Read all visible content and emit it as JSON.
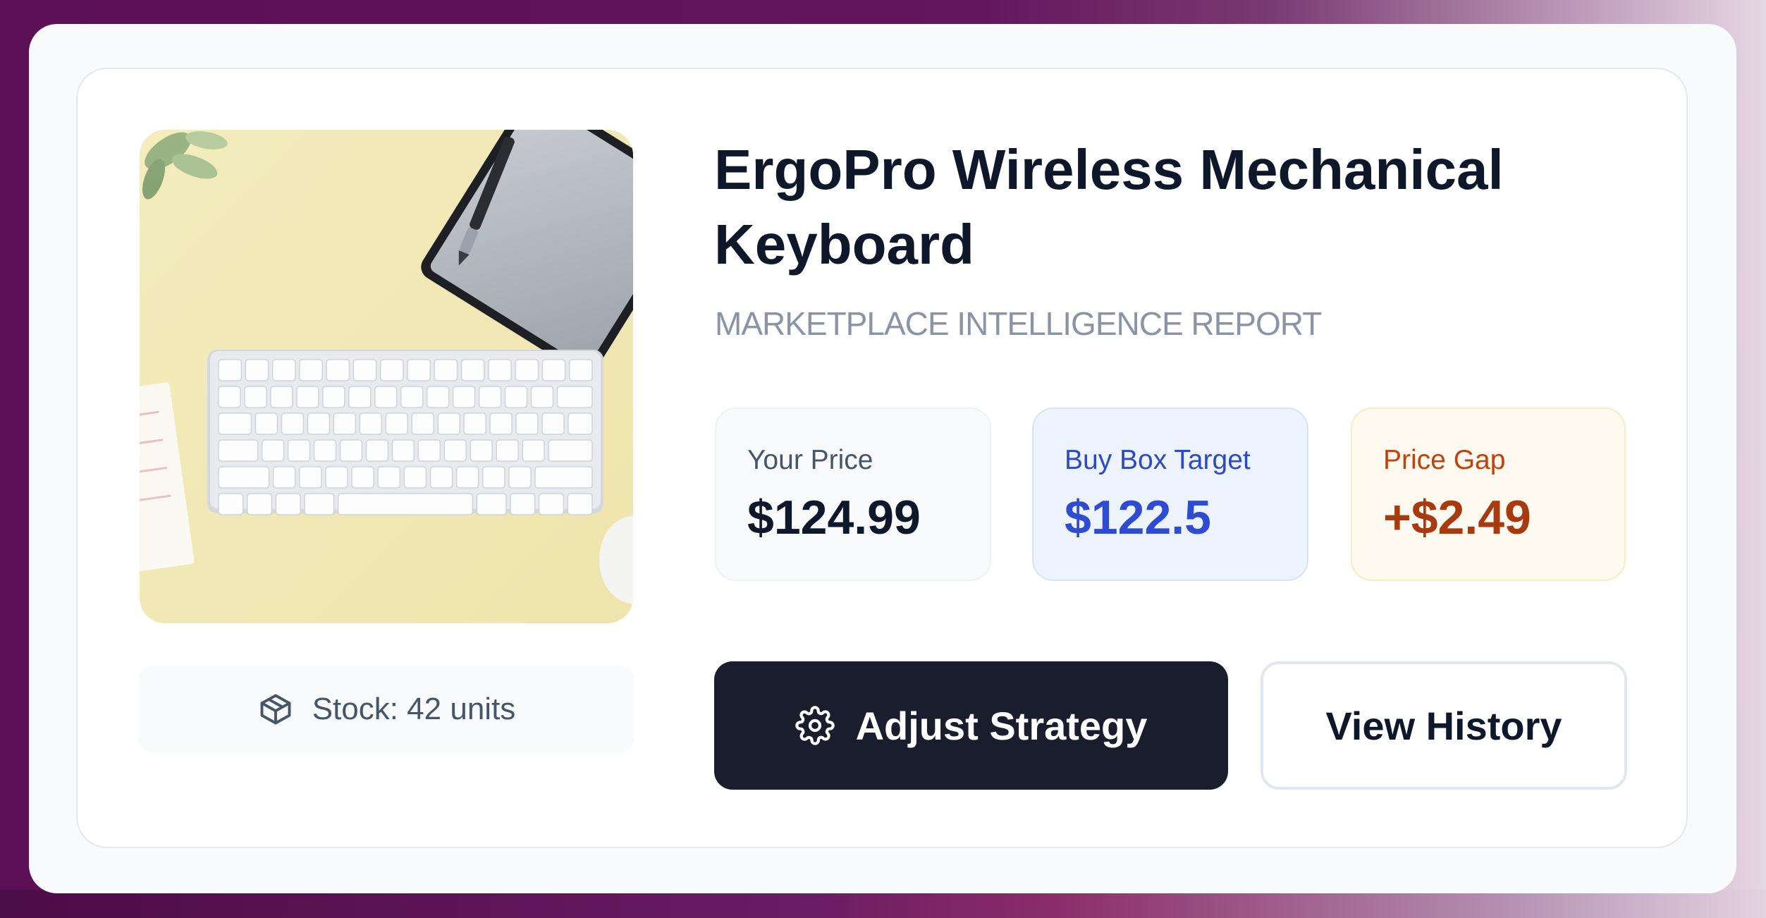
{
  "product": {
    "title": "ErgoPro Wireless Mechanical Keyboard",
    "subtitle": "MARKETPLACE INTELLIGENCE REPORT",
    "image_icon": "keyboard-product-photo"
  },
  "stock": {
    "icon": "box-icon",
    "text": "Stock: 42 units"
  },
  "prices": {
    "your_price": {
      "label": "Your Price",
      "value": "$124.99"
    },
    "buy_box": {
      "label": "Buy Box Target",
      "value": "$122.5"
    },
    "gap": {
      "label": "Price Gap",
      "value": "+$2.49"
    }
  },
  "actions": {
    "adjust_label": "Adjust Strategy",
    "adjust_icon": "gear-icon",
    "history_label": "View History"
  },
  "colors": {
    "backdrop": "#5c0f55",
    "primary_button": "#1a1d2b",
    "buy_box_accent": "#2f4bd3",
    "gap_accent": "#a93a0f",
    "image_background": "#f1e9b5"
  }
}
